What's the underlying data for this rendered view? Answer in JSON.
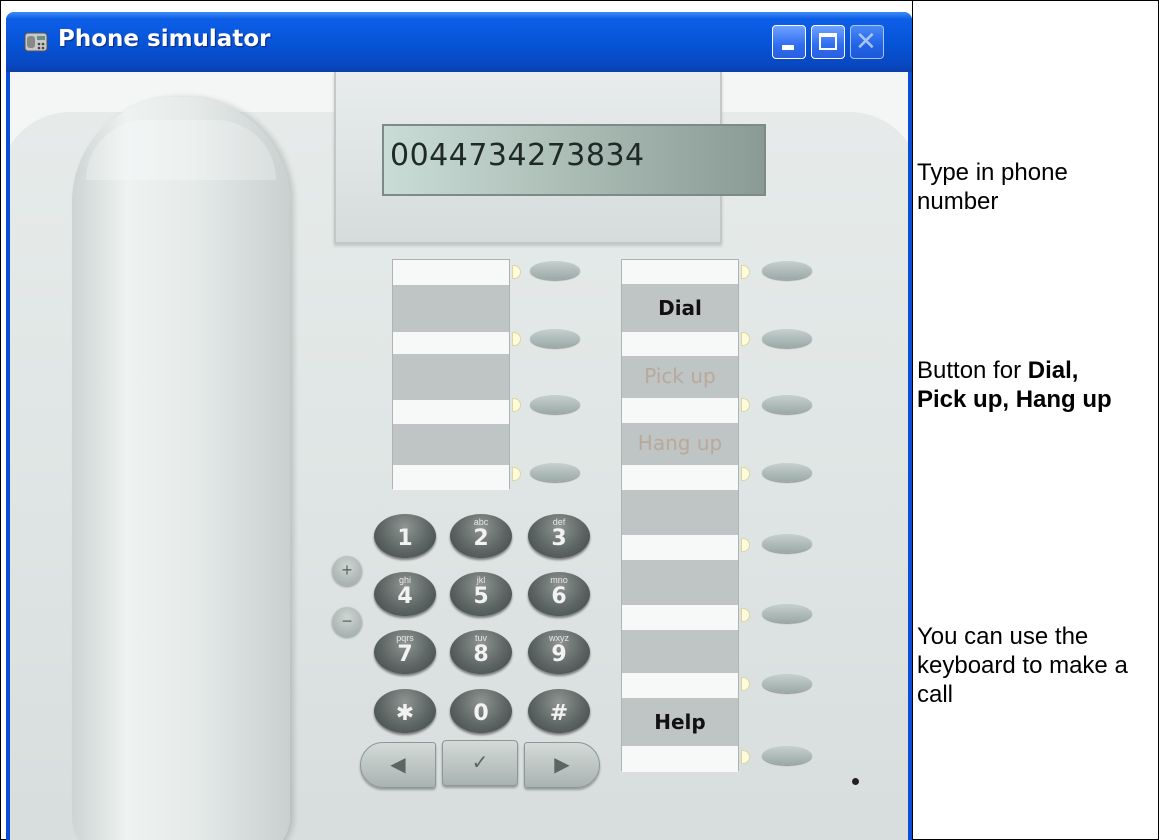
{
  "window": {
    "title": "Phone simulator"
  },
  "display": {
    "number": "0044734273834"
  },
  "softkeys": {
    "dial": "Dial",
    "pick_up": "Pick up",
    "hang_up": "Hang up",
    "help": "Help"
  },
  "keypad": {
    "keys": [
      {
        "digit": "1",
        "letters": ""
      },
      {
        "digit": "2",
        "letters": "abc"
      },
      {
        "digit": "3",
        "letters": "def"
      },
      {
        "digit": "4",
        "letters": "ghi"
      },
      {
        "digit": "5",
        "letters": "jkl"
      },
      {
        "digit": "6",
        "letters": "mno"
      },
      {
        "digit": "7",
        "letters": "pqrs"
      },
      {
        "digit": "8",
        "letters": "tuv"
      },
      {
        "digit": "9",
        "letters": "wxyz"
      },
      {
        "digit": "✱",
        "letters": ""
      },
      {
        "digit": "0",
        "letters": ""
      },
      {
        "digit": "#",
        "letters": ""
      }
    ],
    "volume_up": "+",
    "volume_down": "−",
    "nav_left": "◀",
    "nav_ok": "✓",
    "nav_right": "▶"
  },
  "annotations": {
    "note1": "Type in phone number",
    "note2_prefix": " Button for ",
    "note2_bold1": "Dial,",
    "note2_bold2": "Pick up, Hang up",
    "note3": " You can use the keyboard to make a call"
  },
  "colors": {
    "titlebar": "#0653d6",
    "lcd": "#aebfb8",
    "phone_body": "#dfe5e4",
    "keypad_key": "#5d6664",
    "dim_label": "#b9a99b"
  }
}
